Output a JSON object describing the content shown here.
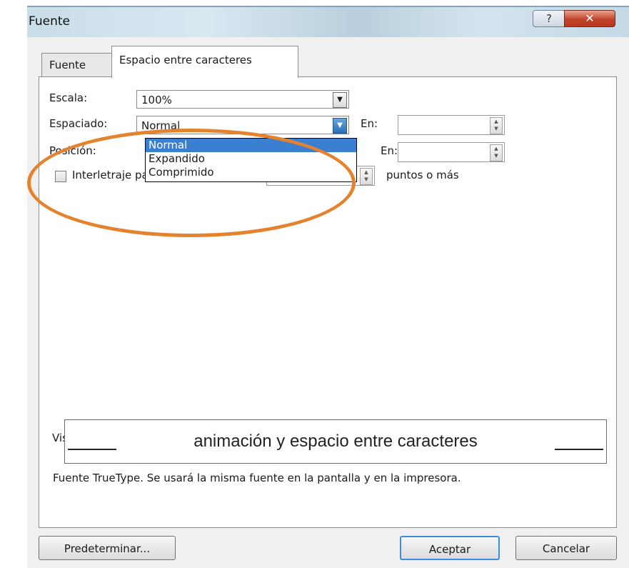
{
  "window": {
    "title": "Fuente",
    "help_label": "?",
    "close_label": "✕"
  },
  "tabs": [
    {
      "label": "Fuente",
      "active": false
    },
    {
      "label": "Espacio entre caracteres",
      "active": true
    }
  ],
  "form": {
    "escala": {
      "label": "Escala:",
      "value": "100%"
    },
    "espaciado": {
      "label": "Espaciado:",
      "value": "Normal",
      "en_label": "En:",
      "en_value": ""
    },
    "posicion": {
      "label": "Posición:",
      "en_label": "En:",
      "en_value": ""
    },
    "interletraje": {
      "label": "Interletraje para fuentes:",
      "checked": false,
      "value": "",
      "suffix": "puntos o más"
    }
  },
  "dropdown": {
    "options": [
      "Normal",
      "Expandido",
      "Comprimido"
    ],
    "selected": "Normal"
  },
  "preview": {
    "label": "Vista previa",
    "text": "animación y espacio entre caracteres",
    "note": "Fuente TrueType. Se usará la misma fuente en la pantalla y en la impresora."
  },
  "buttons": {
    "default": "Predeterminar...",
    "ok": "Aceptar",
    "cancel": "Cancelar"
  },
  "colors": {
    "highlight_circle": "#e4822e",
    "selection": "#3b7fd1",
    "close": "#c2432a"
  },
  "icons": [
    "help-icon",
    "close-icon",
    "chevron-down-icon",
    "spin-arrows-icon"
  ]
}
